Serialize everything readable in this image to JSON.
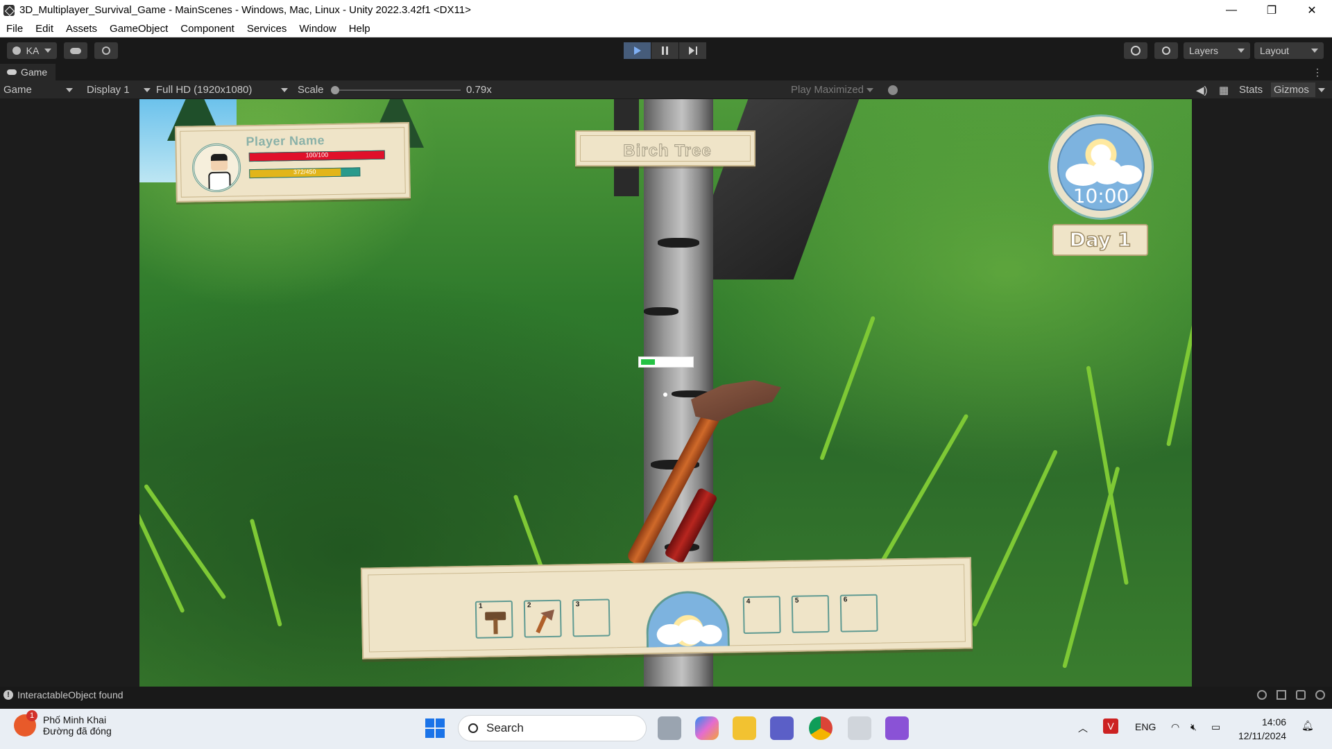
{
  "window": {
    "title": "3D_Multiplayer_Survival_Game - MainScenes - Windows, Mac, Linux - Unity 2022.3.42f1 <DX11>",
    "controls": {
      "minimize": "—",
      "restore": "❐",
      "close": "✕"
    }
  },
  "menu": [
    "File",
    "Edit",
    "Assets",
    "GameObject",
    "Component",
    "Services",
    "Window",
    "Help"
  ],
  "toolbar": {
    "account": "KA",
    "layers_label": "Layers",
    "layout_label": "Layout",
    "play_state": "playing"
  },
  "game_tab": {
    "tab_label": "Game",
    "view_mode": "Game",
    "display": "Display 1",
    "resolution": "Full HD (1920x1080)",
    "scale_label": "Scale",
    "scale_value": "0.79x",
    "play_mode": "Play Maximized",
    "stats_label": "Stats",
    "gizmos_label": "Gizmos"
  },
  "hud": {
    "player_name": "Player Name",
    "health_text": "100/100",
    "health_fraction": 1.0,
    "stamina_text": "372/450",
    "stamina_fraction": 0.83,
    "target_name": "Birch Tree",
    "clock_time": "10:00",
    "day_label": "Day 1",
    "chop_progress_fraction": 0.28,
    "hotbar_slots": [
      {
        "num": "1",
        "item": "hammer"
      },
      {
        "num": "2",
        "item": "axe"
      },
      {
        "num": "3",
        "item": ""
      },
      {
        "num": "4",
        "item": ""
      },
      {
        "num": "5",
        "item": ""
      },
      {
        "num": "6",
        "item": ""
      }
    ]
  },
  "status": {
    "message": "InteractableObject found"
  },
  "taskbar": {
    "weather_title": "Phố Minh Khai",
    "weather_subtitle": "Đường đã đóng",
    "weather_badge": "1",
    "search_placeholder": "Search",
    "lang": "ENG",
    "time": "14:06",
    "date": "12/11/2024"
  },
  "colors": {
    "health": "#e0102a",
    "stamina_fill": "#e2b51a",
    "stamina_track": "#2a9a8c",
    "progress": "#25c244",
    "play_active": "#465c7a"
  }
}
